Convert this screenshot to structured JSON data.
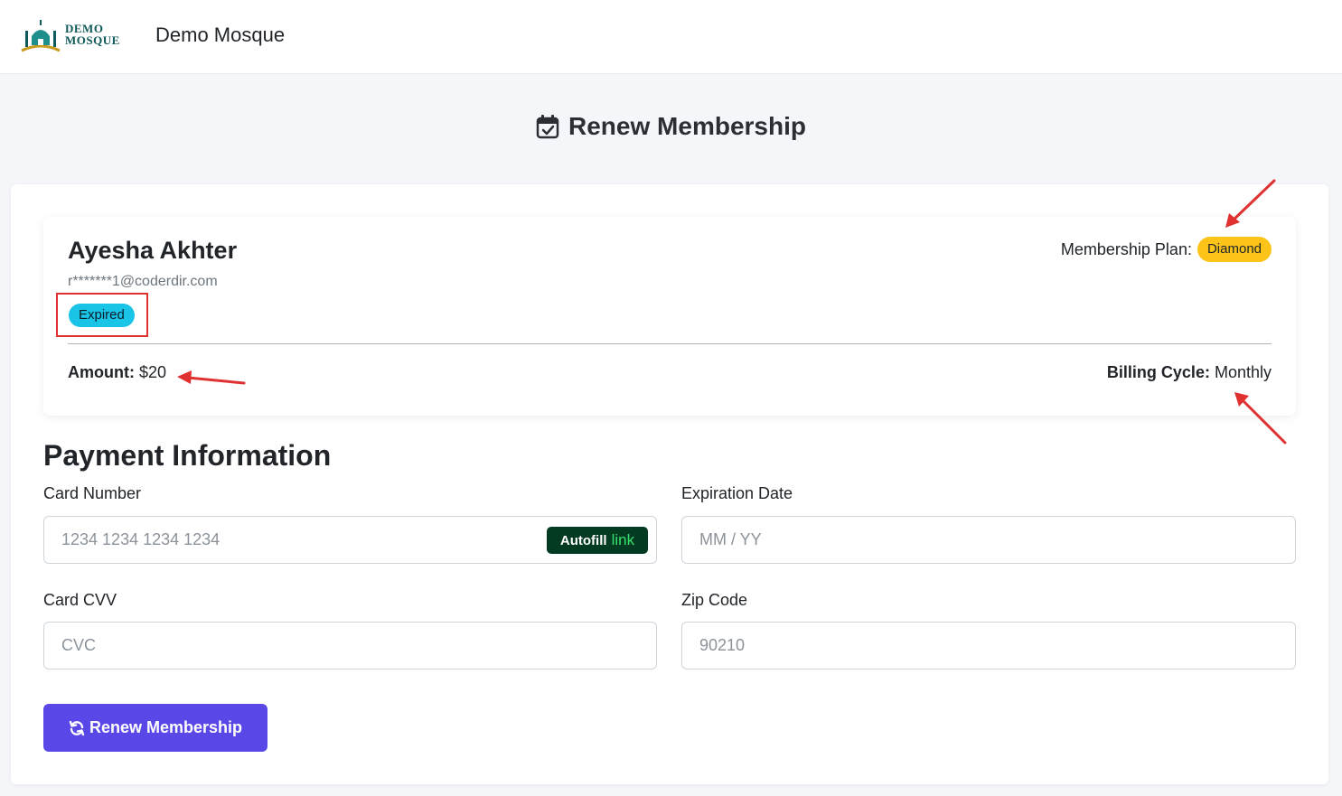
{
  "navbar": {
    "logo_text_line1": "DEMO",
    "logo_text_line2": "MOSQUE",
    "brand_name": "Demo Mosque"
  },
  "page": {
    "title": "Renew Membership",
    "title_icon": "calendar-check-icon"
  },
  "member": {
    "name": "Ayesha Akhter",
    "email": "r*******1@coderdir.com",
    "status": "Expired",
    "plan_label": "Membership Plan:",
    "plan_value": "Diamond",
    "amount_label": "Amount:",
    "amount_value": "$20",
    "billing_label": "Billing Cycle:",
    "billing_value": "Monthly"
  },
  "payment": {
    "section_title": "Payment Information",
    "card_number": {
      "label": "Card Number",
      "placeholder": "1234 1234 1234 1234",
      "value": ""
    },
    "autofill": {
      "label": "Autofill",
      "link_text": "link"
    },
    "expiration": {
      "label": "Expiration Date",
      "placeholder": "MM / YY",
      "value": ""
    },
    "cvv": {
      "label": "Card CVV",
      "placeholder": "CVC",
      "value": ""
    },
    "zip": {
      "label": "Zip Code",
      "placeholder": "90210",
      "value": ""
    },
    "submit_label": "Renew Membership",
    "submit_icon": "refresh-icon"
  },
  "colors": {
    "primary": "#5a47e8",
    "status_badge": "#19c4e6",
    "plan_badge": "#fcc419",
    "annotation": "#e03131",
    "autofill_bg": "#033b22",
    "autofill_link": "#36e06b"
  }
}
